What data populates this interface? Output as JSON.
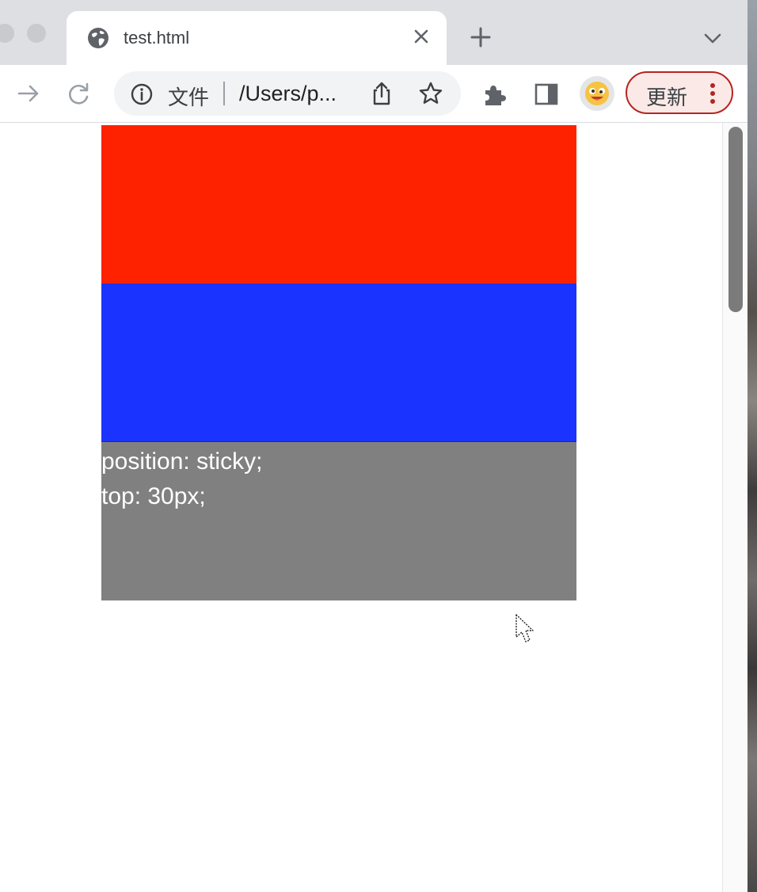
{
  "tab": {
    "title": "test.html"
  },
  "omnibox": {
    "scheme_label": "文件",
    "url": "/Users/p..."
  },
  "toolbar": {
    "update_label": "更新"
  },
  "content": {
    "sticky_lines": [
      "position: sticky;",
      "top: 30px;"
    ],
    "box_colors": {
      "red": "#ff2200",
      "blue": "#1a33ff",
      "gray": "#808080"
    }
  },
  "icons": [
    "globe-icon",
    "close-icon",
    "plus-icon",
    "chevron-down-icon",
    "forward-arrow-icon",
    "reload-icon",
    "info-icon",
    "share-icon",
    "star-icon",
    "puzzle-icon",
    "side-panel-icon",
    "avatar-icon",
    "more-vert-icon",
    "mouse-cursor-icon"
  ],
  "accent": {
    "update_border": "#b3261e",
    "update_bg": "#fbe9e8"
  }
}
